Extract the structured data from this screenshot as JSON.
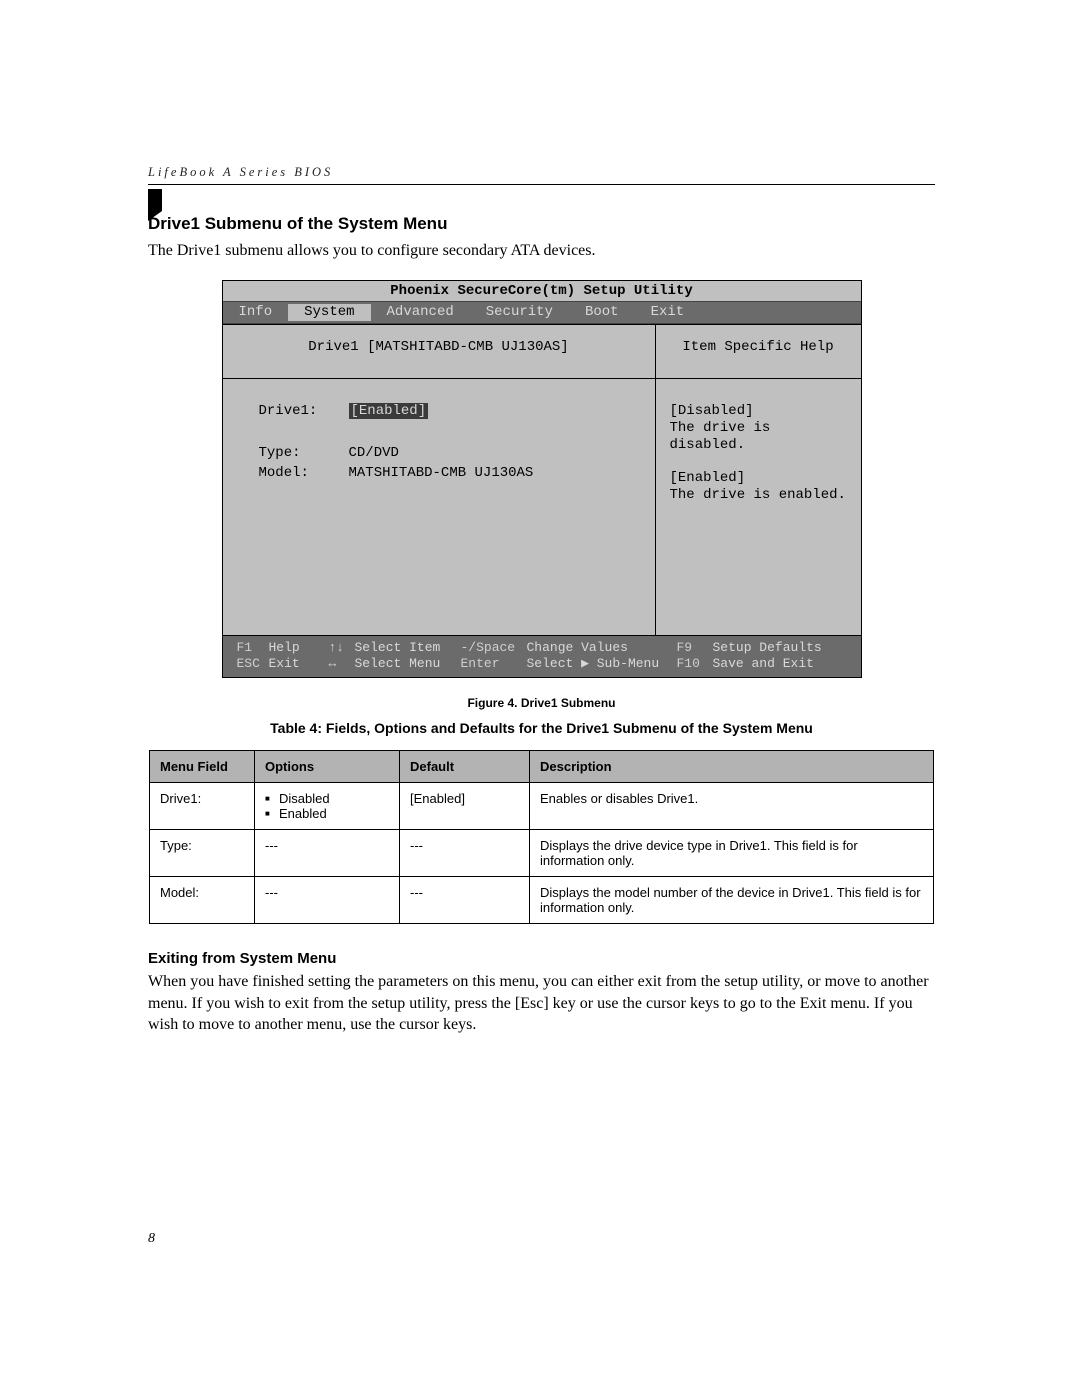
{
  "running_head": "LifeBook A Series BIOS",
  "section_heading": "Drive1 Submenu of the System Menu",
  "intro_paragraph": "The Drive1 submenu allows you to configure secondary ATA devices.",
  "bios": {
    "title": "Phoenix SecureCore(tm) Setup Utility",
    "menus": [
      "Info",
      "System",
      "Advanced",
      "Security",
      "Boot",
      "Exit"
    ],
    "selected_menu": "System",
    "submenu_title": "Drive1 [MATSHITABD-CMB UJ130AS]",
    "help_title": "Item Specific Help",
    "fields": [
      {
        "label": "Drive1:",
        "value": "[Enabled]",
        "highlighted": true
      },
      {
        "label": "",
        "value": ""
      },
      {
        "label": "Type:",
        "value": "CD/DVD"
      },
      {
        "label": "Model:",
        "value": "MATSHITABD-CMB UJ130AS"
      }
    ],
    "help_lines": [
      "[Disabled]",
      "The drive is disabled.",
      "",
      "[Enabled]",
      "The drive is enabled."
    ],
    "footer": {
      "row1": {
        "k1": "F1",
        "l1": "Help",
        "k2": "↑↓",
        "l2": "Select Item",
        "k3": "-/Space",
        "l3": "Change Values",
        "k4": "F9",
        "l4": "Setup Defaults"
      },
      "row2": {
        "k1": "ESC",
        "l1": "Exit",
        "k2": "↔",
        "l2": "Select Menu",
        "k3": "Enter",
        "l3": "Select ▶ Sub-Menu",
        "k4": "F10",
        "l4": "Save and Exit"
      }
    }
  },
  "figure_caption": "Figure 4.  Drive1 Submenu",
  "table_caption": "Table 4: Fields, Options and Defaults for the Drive1 Submenu of the System Menu",
  "table": {
    "headers": [
      "Menu Field",
      "Options",
      "Default",
      "Description"
    ],
    "rows": [
      {
        "field": "Drive1:",
        "options": [
          "Disabled",
          "Enabled"
        ],
        "default": "[Enabled]",
        "desc": "Enables or disables Drive1."
      },
      {
        "field": "Type:",
        "options_text": "---",
        "default": "---",
        "desc": "Displays the drive device type in Drive1. This field is for information only."
      },
      {
        "field": "Model:",
        "options_text": "---",
        "default": "---",
        "desc": "Displays the model number of the device in Drive1. This field is for information only."
      }
    ]
  },
  "exit_heading": "Exiting from System Menu",
  "exit_paragraph": "When you have finished setting the parameters on this menu, you can either exit from the setup utility, or move to another menu. If you wish to exit from the setup utility, press the [Esc] key or use the cursor keys to go to the Exit menu. If you wish to move to another menu, use the cursor keys.",
  "page_number": "8"
}
